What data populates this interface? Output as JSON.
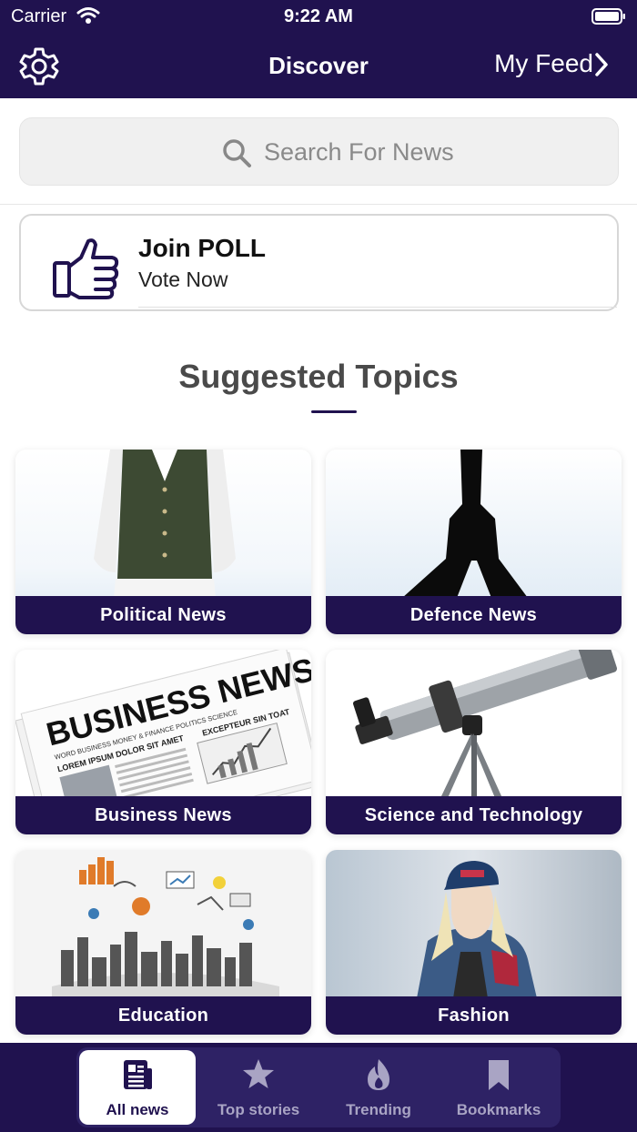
{
  "status_bar": {
    "carrier": "Carrier",
    "time": "9:22 AM"
  },
  "nav": {
    "title": "Discover",
    "right_label": "My Feed"
  },
  "search": {
    "placeholder": "Search For News",
    "value": ""
  },
  "poll": {
    "title": "Join POLL",
    "subtitle": "Vote Now"
  },
  "suggested": {
    "heading": "Suggested Topics",
    "topics": [
      {
        "label": "Political News"
      },
      {
        "label": "Defence News"
      },
      {
        "label": "Business News"
      },
      {
        "label": "Science and Technology"
      },
      {
        "label": "Education"
      },
      {
        "label": "Fashion"
      }
    ]
  },
  "newspaper": {
    "masthead": "BUSINESS NEWS",
    "line1": "WORD BUSINESS MONEY & FINANCE POLITICS SCIENCE",
    "line2": "LOREM IPSUM DOLOR SIT AMET",
    "line3": "EXCEPTEUR SIN TOAT"
  },
  "tabs": [
    {
      "label": "All news",
      "icon": "newspaper-icon",
      "active": true
    },
    {
      "label": "Top stories",
      "icon": "star-icon",
      "active": false
    },
    {
      "label": "Trending",
      "icon": "flame-icon",
      "active": false
    },
    {
      "label": "Bookmarks",
      "icon": "bookmark-icon",
      "active": false
    }
  ],
  "colors": {
    "brand": "#20124f",
    "tab_inactive": "#a9a4c4",
    "background": "#ffffff"
  }
}
